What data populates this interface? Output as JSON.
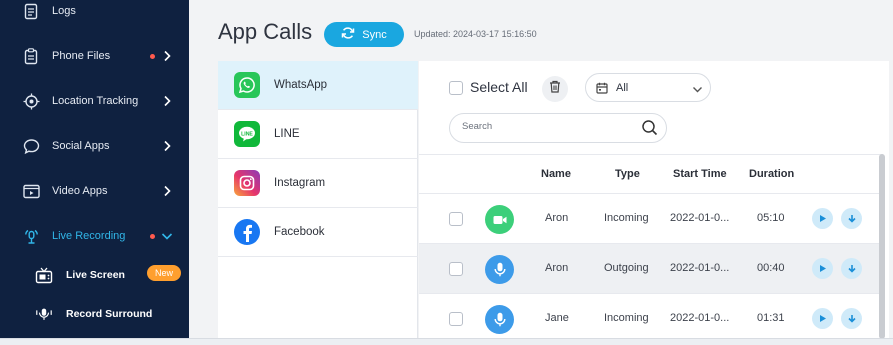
{
  "sidebar": {
    "items": [
      {
        "label": "Logs",
        "icon": "logs-icon"
      },
      {
        "label": "Phone Files",
        "icon": "phone-files-icon",
        "dot": true
      },
      {
        "label": "Location Tracking",
        "icon": "location-icon"
      },
      {
        "label": "Social Apps",
        "icon": "chat-bubble-icon"
      },
      {
        "label": "Video Apps",
        "icon": "video-icon"
      },
      {
        "label": "Live Recording",
        "icon": "live-recording-icon",
        "dot": true,
        "expanded": true
      }
    ],
    "subitems": [
      {
        "label": "Live Screen",
        "icon": "tv-icon",
        "badge": "New"
      },
      {
        "label": "Record Surround",
        "icon": "surround-icon"
      }
    ]
  },
  "header": {
    "title": "App Calls",
    "sync_label": "Sync",
    "updated": "Updated: 2024-03-17 15:16:50"
  },
  "apps": [
    {
      "label": "WhatsApp",
      "icon": "whatsapp-icon",
      "selected": true
    },
    {
      "label": "LINE",
      "icon": "line-icon"
    },
    {
      "label": "Instagram",
      "icon": "instagram-icon"
    },
    {
      "label": "Facebook",
      "icon": "facebook-icon"
    }
  ],
  "toolbar": {
    "select_all": "Select All",
    "filter_value": "All",
    "search_placeholder": "Search"
  },
  "table": {
    "headers": [
      "Name",
      "Type",
      "Start Time",
      "Duration"
    ],
    "rows": [
      {
        "call_icon": "video-call-icon",
        "name": "Aron",
        "type": "Incoming",
        "start": "2022-01-0...",
        "duration": "05:10"
      },
      {
        "call_icon": "mic-icon",
        "name": "Aron",
        "type": "Outgoing",
        "start": "2022-01-0...",
        "duration": "00:40"
      },
      {
        "call_icon": "mic-icon",
        "name": "Jane",
        "type": "Incoming",
        "start": "2022-01-0...",
        "duration": "01:31"
      }
    ]
  },
  "colors": {
    "sidebar_bg": "#0f2140",
    "accent": "#1aa7e0",
    "active_nav": "#31b6e8",
    "dot": "#ff5a4e",
    "badge": "#ff9f2e",
    "video_call": "#3ccf7a",
    "voice_call": "#3d9be9"
  }
}
